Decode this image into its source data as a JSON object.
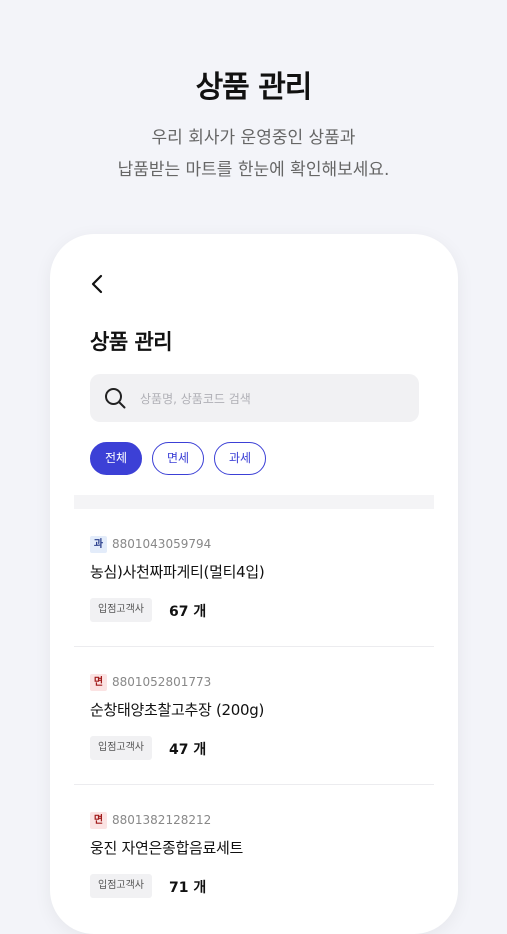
{
  "hero": {
    "title": "상품 관리",
    "subtitle_line1": "우리 회사가 운영중인 상품과",
    "subtitle_line2": "납품받는 마트를 한눈에 확인해보세요."
  },
  "screen": {
    "title": "상품 관리",
    "back_icon": "chevron-left-icon",
    "search": {
      "placeholder": "상품명, 상품코드 검색",
      "icon": "search-icon"
    },
    "filters": [
      {
        "label": "전체",
        "active": true
      },
      {
        "label": "면세",
        "active": false
      },
      {
        "label": "과세",
        "active": false
      }
    ]
  },
  "products": [
    {
      "badge": "과",
      "badge_type": "tax",
      "code": "8801043059794",
      "name": "농심)사천짜파게티(멀티4입)",
      "tag": "입점고객사",
      "qty": "67 개"
    },
    {
      "badge": "면",
      "badge_type": "free",
      "code": "8801052801773",
      "name": "순창태양초찰고추장 (200g)",
      "tag": "입점고객사",
      "qty": "47 개"
    },
    {
      "badge": "면",
      "badge_type": "free",
      "code": "8801382128212",
      "name": "웅진 자연은종합음료세트",
      "tag": "입점고객사",
      "qty": "71 개"
    }
  ],
  "colors": {
    "accent": "#3c40d6",
    "background": "#f3f4f9",
    "tax_badge": "#e3ecfa",
    "free_badge": "#fbe3e3"
  }
}
